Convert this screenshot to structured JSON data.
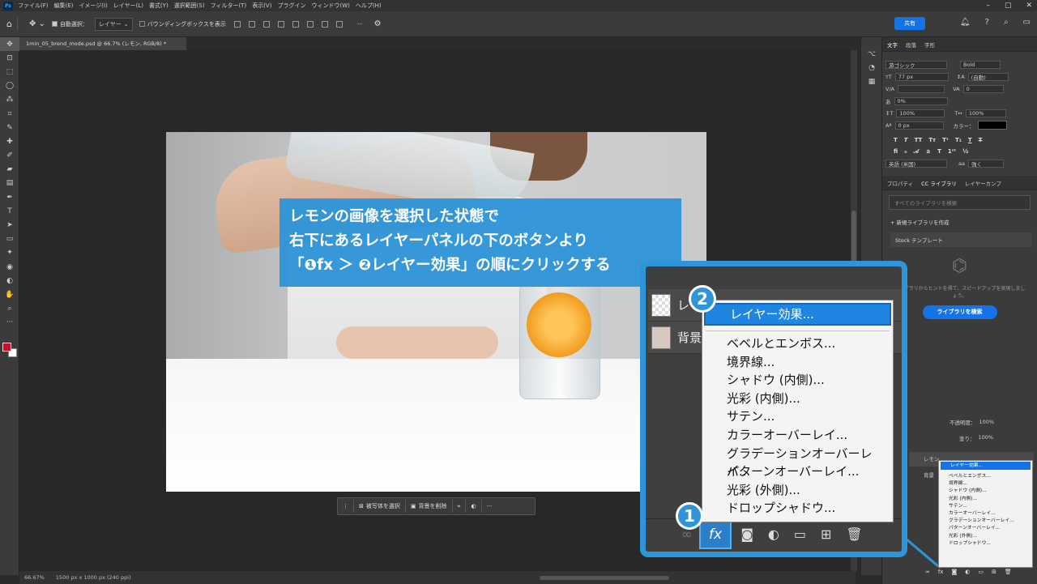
{
  "menubar": {
    "app_icon": "Ps",
    "items": [
      "ファイル(F)",
      "編集(E)",
      "イメージ(I)",
      "レイヤー(L)",
      "書式(Y)",
      "選択範囲(S)",
      "フィルター(T)",
      "表示(V)",
      "プラグイン",
      "ウィンドウ(W)",
      "ヘルプ(H)"
    ]
  },
  "options": {
    "auto_select": "自動選択：",
    "layer_select": "レイヤー",
    "show_transform": "バウンディングボックスを表示",
    "share": "共有"
  },
  "document": {
    "tab": "1min_05_brend_mode.psd @ 66.7% (レモン, RGB/8) *"
  },
  "context_bar": {
    "select_subject": "被写体を選択",
    "remove_bg": "背景を削除",
    "more": "···"
  },
  "status": {
    "zoom": "66.67%",
    "size": "1500 px x 1000 px (240 ppi)"
  },
  "char_panel": {
    "tabs": [
      "文字",
      "段落",
      "字形"
    ],
    "font": "游ゴシック",
    "weight": "Bold",
    "size": "77 px",
    "leading": "(自動)",
    "kerning": "",
    "tracking": "0",
    "tsume": "0%",
    "vscale": "100%",
    "hscale": "100%",
    "baseline": "0 px",
    "color_label": "カラー：",
    "lang": "英語 (米国)",
    "aa": "aa",
    "aa_mode": "強く"
  },
  "lib_panel": {
    "tabs": [
      "プロパティ",
      "CC ライブラリ",
      "レイヤーカンプ"
    ],
    "search_placeholder": "すべてのライブラリを検索",
    "new_library": "+ 新規ライブラリを作成",
    "stock": "Stock テンプレート",
    "hint": "ライブラリからヒントを得て、スピードアップを実現しましょう。",
    "search_btn": "ライブラリを検索"
  },
  "layers_panel": {
    "opacity_label": "不透明度：",
    "opacity": "100%",
    "fill_label": "塗り：",
    "fill": "100%",
    "layer1": "レモン",
    "layer2": "背景"
  },
  "callout": {
    "line1": "レモンの画像を選択した状態で",
    "line2": "右下にあるレイヤーパネルの下のボタンより",
    "line3": "「❶fx ＞ ❷レイヤー効果」の順にクリックする"
  },
  "fx_menu": {
    "header": "レイヤー効果...",
    "items": [
      "ベベルとエンボス...",
      "境界線...",
      "シャドウ (内側)...",
      "光彩 (内側)...",
      "サテン...",
      "カラーオーバーレイ...",
      "グラデーションオーバーレイ...",
      "パターンオーバーレイ...",
      "光彩 (外側)...",
      "ドロップシャドウ..."
    ]
  },
  "zoom_layers": {
    "layer1": "レモ",
    "layer2": "背景"
  },
  "badges": {
    "one": "1",
    "two": "2"
  },
  "fx_label": "fx",
  "colors": {
    "accent": "#2f95d8",
    "fg_swatch": "#c8102e",
    "menu_highlight": "#1473e6"
  }
}
